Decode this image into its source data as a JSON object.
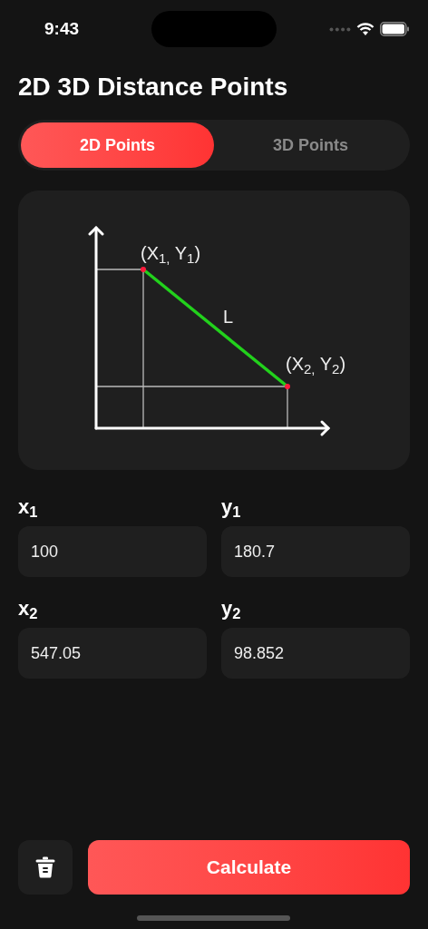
{
  "status_bar": {
    "time": "9:43"
  },
  "title": "2D 3D Distance Points",
  "tabs": [
    {
      "label": "2D Points",
      "selected": true
    },
    {
      "label": "3D Points",
      "selected": false
    }
  ],
  "diagram": {
    "point_1": "(X$_{1,}$ Y$_{1}$)",
    "line": "L",
    "point_2": "(X$_{2,}$ Y$_{2}$)"
  },
  "fields": [
    {
      "label": "x$_{1}$",
      "value": "100"
    },
    {
      "label": "y$_{1}$",
      "value": "180.7"
    },
    {
      "label": "x$_{2}$",
      "value": "547.05"
    },
    {
      "label": "y$_{2}$",
      "value": "98.852"
    }
  ],
  "buttons": {
    "primary": "Calculate"
  }
}
